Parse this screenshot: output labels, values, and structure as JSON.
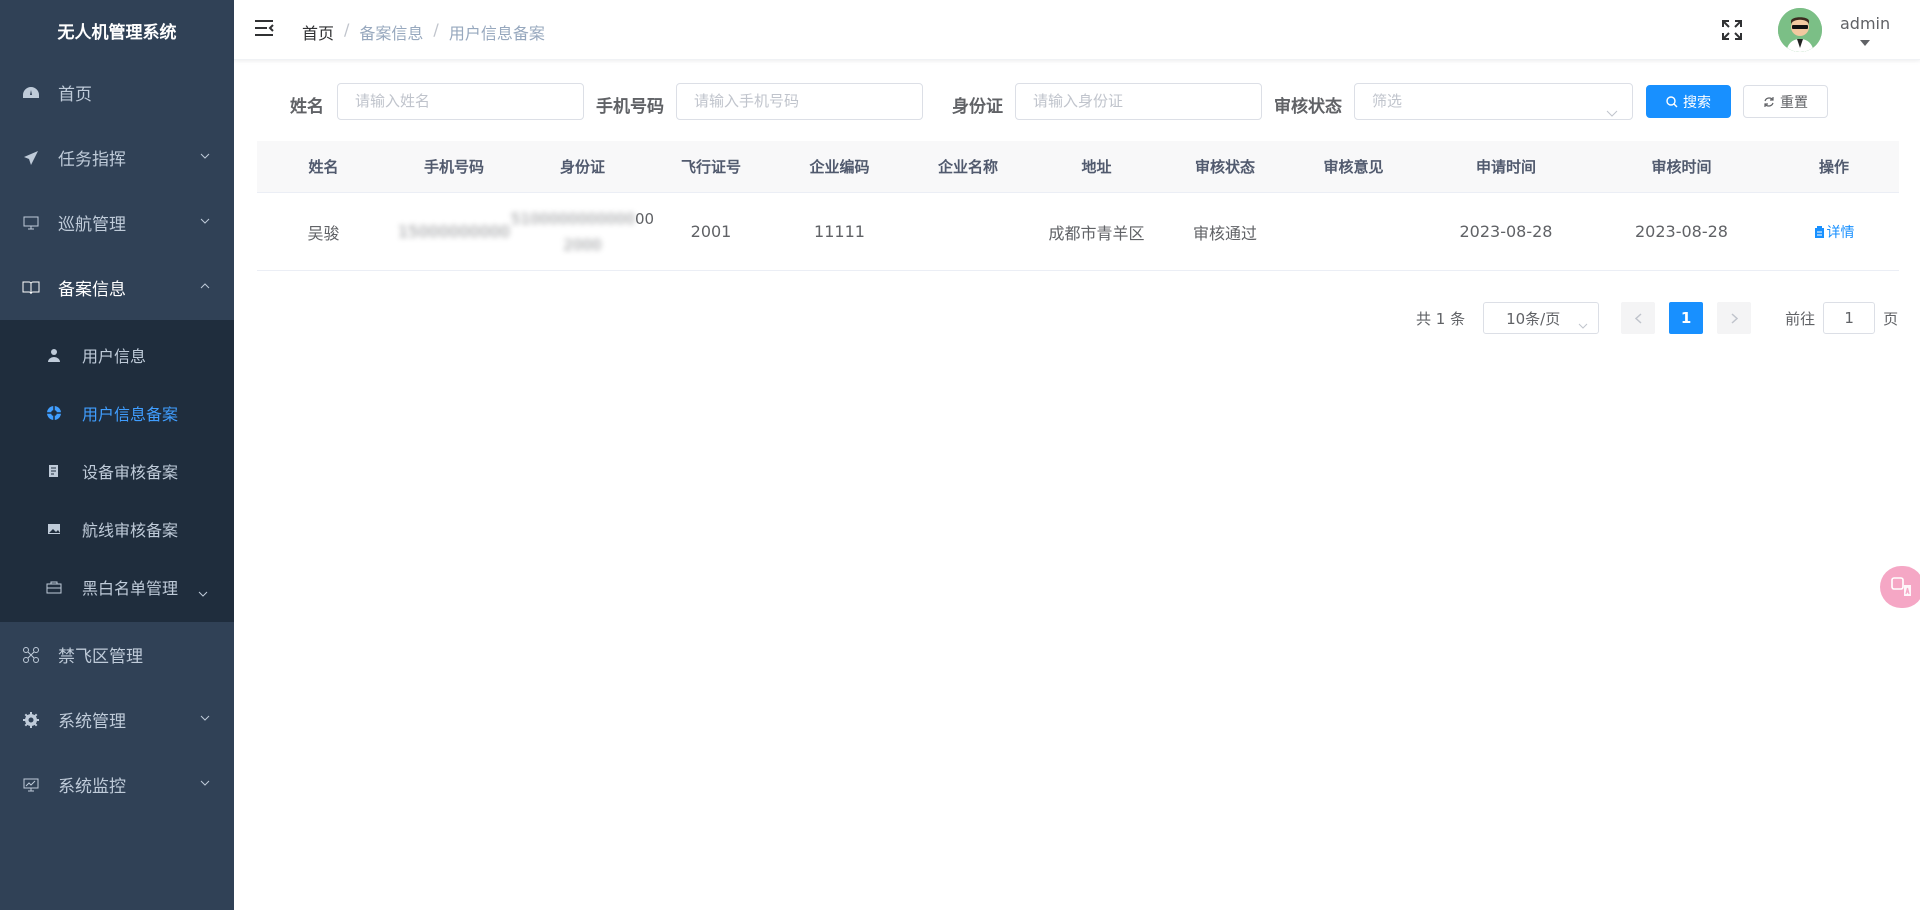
{
  "sidebar": {
    "logo": "无人机管理系统",
    "menu": [
      {
        "label": "首页",
        "icon": "dashboard-icon"
      },
      {
        "label": "任务指挥",
        "icon": "send-icon"
      },
      {
        "label": "巡航管理",
        "icon": "monitor-icon"
      },
      {
        "label": "备案信息",
        "icon": "book-icon"
      }
    ],
    "submenu": [
      {
        "label": "用户信息",
        "icon": "user-icon"
      },
      {
        "label": "用户信息备案",
        "icon": "target-icon"
      },
      {
        "label": "设备审核备案",
        "icon": "document-icon"
      },
      {
        "label": "航线审核备案",
        "icon": "image-icon"
      },
      {
        "label": "黑白名单管理",
        "icon": "briefcase-icon"
      }
    ],
    "menu_after": [
      {
        "label": "禁飞区管理",
        "icon": "drone-icon"
      },
      {
        "label": "系统管理",
        "icon": "gear-icon"
      },
      {
        "label": "系统监控",
        "icon": "chart-monitor-icon"
      }
    ]
  },
  "header": {
    "breadcrumb": [
      "首页",
      "备案信息",
      "用户信息备案"
    ],
    "username": "admin"
  },
  "search": {
    "name_label": "姓名",
    "name_placeholder": "请输入姓名",
    "phone_label": "手机号码",
    "phone_placeholder": "请输入手机号码",
    "id_label": "身份证",
    "id_placeholder": "请输入身份证",
    "status_label": "审核状态",
    "status_placeholder": "筛选",
    "search_button": "搜索",
    "reset_button": "重置"
  },
  "table": {
    "columns": [
      "姓名",
      "手机号码",
      "身份证",
      "飞行证号",
      "企业编码",
      "企业名称",
      "地址",
      "审核状态",
      "审核意见",
      "申请时间",
      "审核时间",
      "操作"
    ],
    "rows": [
      {
        "name": "吴骏",
        "phone": "15000000000",
        "id_line1": "5100000000000",
        "id_line1_tail": "00",
        "id_line2": "2000",
        "flight_no": "2001",
        "company_code": "11111",
        "company_name": "",
        "address": "成都市青羊区",
        "status": "审核通过",
        "opinion": "",
        "apply_time": "2023-08-28",
        "review_time": "2023-08-28",
        "action": "详情"
      }
    ]
  },
  "pagination": {
    "total": "共 1 条",
    "page_size": "10条/页",
    "current": "1",
    "goto_label": "前往",
    "goto_value": "1",
    "page_suffix": "页"
  },
  "colors": {
    "sidebar": "#304156",
    "submenu": "#1f2d3d",
    "accent": "#1890ff",
    "active_text": "#409eff"
  }
}
